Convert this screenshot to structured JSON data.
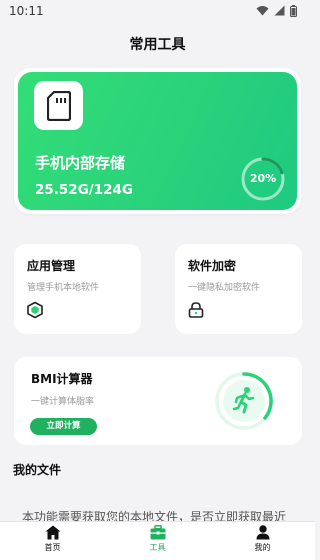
{
  "status_bar": {
    "time": "10:11"
  },
  "page_title": "常用工具",
  "storage": {
    "title": "手机内部存储",
    "size": "25.52G/124G",
    "percent_label": "20%",
    "percent": 20
  },
  "tools": {
    "app_manage": {
      "title": "应用管理",
      "desc": "管理手机本地软件"
    },
    "app_encrypt": {
      "title": "软件加密",
      "desc": "一键隐私加密软件"
    }
  },
  "bmi": {
    "title": "BMI计算器",
    "desc": "一键计算体脂率",
    "button": "立即计算"
  },
  "files": {
    "title": "我的文件",
    "notice": "本功能需要获取您的本地文件，是否立即获取最近"
  },
  "tab_bar": {
    "items": [
      {
        "label": "首页",
        "icon": "home-icon"
      },
      {
        "label": "工具",
        "icon": "toolbox-icon"
      },
      {
        "label": "我的",
        "icon": "user-icon"
      }
    ],
    "active_index": 1
  },
  "colors": {
    "accent_green": "#1fb060",
    "card_gradient_start": "#33dd77",
    "card_gradient_end": "#1ec982"
  }
}
